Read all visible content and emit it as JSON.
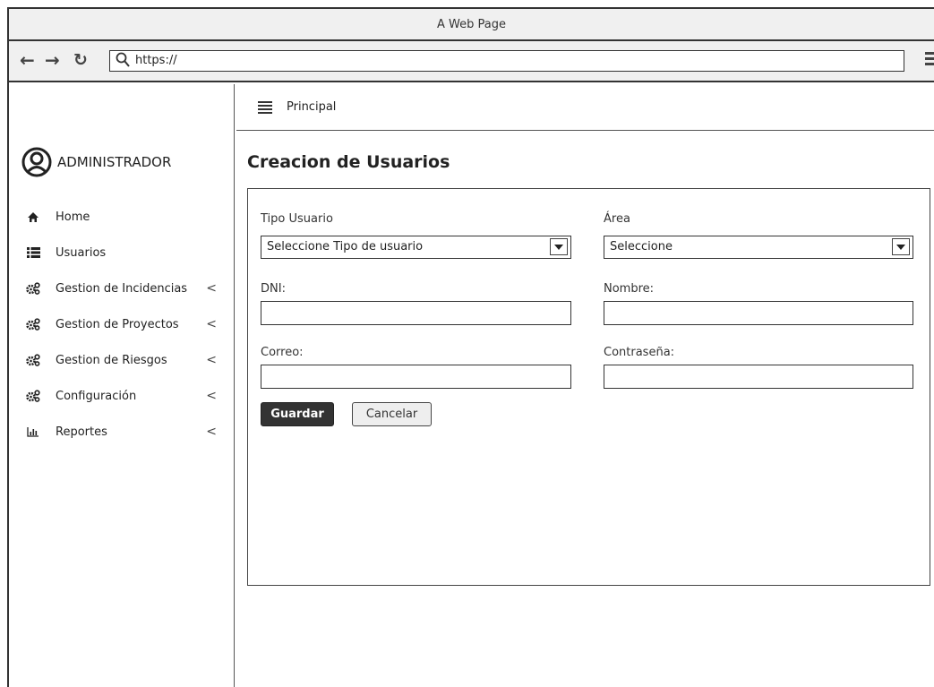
{
  "browser": {
    "title": "A Web Page",
    "url": "https://"
  },
  "sidebar": {
    "user": "ADMINISTRADOR",
    "items": [
      {
        "label": "Home",
        "icon": "home-icon",
        "arrow": ""
      },
      {
        "label": "Usuarios",
        "icon": "list-icon",
        "arrow": ""
      },
      {
        "label": "Gestion de Incidencias",
        "icon": "gears-icon",
        "arrow": "<"
      },
      {
        "label": "Gestion de Proyectos",
        "icon": "gears-icon",
        "arrow": "<"
      },
      {
        "label": "Gestion de Riesgos",
        "icon": "gears-icon",
        "arrow": "<"
      },
      {
        "label": "Configuración",
        "icon": "gears-icon",
        "arrow": "<"
      },
      {
        "label": "Reportes",
        "icon": "bar-chart-icon",
        "arrow": "<"
      }
    ]
  },
  "header": {
    "label": "Principal"
  },
  "page": {
    "title": "Creacion de Usuarios"
  },
  "form": {
    "tipo_usuario": {
      "label": "Tipo Usuario",
      "value": "Seleccione Tipo de usuario"
    },
    "area": {
      "label": "Área",
      "value": "Seleccione"
    },
    "dni": {
      "label": "DNI:",
      "value": ""
    },
    "nombre": {
      "label": "Nombre:",
      "value": ""
    },
    "correo": {
      "label": "Correo:",
      "value": ""
    },
    "contrasena": {
      "label": "Contraseña:",
      "value": ""
    },
    "save_label": "Guardar",
    "cancel_label": "Cancelar"
  }
}
